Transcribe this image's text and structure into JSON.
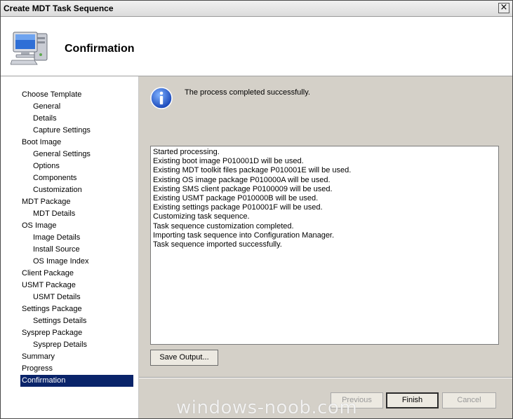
{
  "window": {
    "title": "Create MDT Task Sequence",
    "close_glyph": "×"
  },
  "header": {
    "title": "Confirmation",
    "icon": "computer-icon"
  },
  "sidebar": {
    "items": [
      {
        "label": "Choose Template",
        "level": 0
      },
      {
        "label": "General",
        "level": 1
      },
      {
        "label": "Details",
        "level": 1
      },
      {
        "label": "Capture Settings",
        "level": 1
      },
      {
        "label": "Boot Image",
        "level": 0
      },
      {
        "label": "General Settings",
        "level": 1
      },
      {
        "label": "Options",
        "level": 1
      },
      {
        "label": "Components",
        "level": 1
      },
      {
        "label": "Customization",
        "level": 1
      },
      {
        "label": "MDT Package",
        "level": 0
      },
      {
        "label": "MDT Details",
        "level": 1
      },
      {
        "label": "OS Image",
        "level": 0
      },
      {
        "label": "Image Details",
        "level": 1
      },
      {
        "label": "Install Source",
        "level": 1
      },
      {
        "label": "OS Image Index",
        "level": 1
      },
      {
        "label": "Client Package",
        "level": 0
      },
      {
        "label": "USMT Package",
        "level": 0
      },
      {
        "label": "USMT Details",
        "level": 1
      },
      {
        "label": "Settings Package",
        "level": 0
      },
      {
        "label": "Settings Details",
        "level": 1
      },
      {
        "label": "Sysprep Package",
        "level": 0
      },
      {
        "label": "Sysprep Details",
        "level": 1
      },
      {
        "label": "Summary",
        "level": 0
      },
      {
        "label": "Progress",
        "level": 0
      },
      {
        "label": "Confirmation",
        "level": 0,
        "selected": true
      }
    ]
  },
  "main": {
    "status_icon": "info-icon",
    "status_message": "The process completed successfully.",
    "output_lines": [
      "Started processing.",
      "Existing boot image P010001D will be used.",
      "Existing MDT toolkit files package P010001E will be used.",
      "Existing OS image package P010000A will be used.",
      "Existing SMS client package P0100009 will be used.",
      "Existing USMT package P010000B will be used.",
      "Existing settings package P010001F will be used.",
      "Customizing task sequence.",
      "Task sequence customization completed.",
      "Importing task sequence into Configuration Manager.",
      "Task sequence imported successfully."
    ],
    "save_output_label": "Save Output..."
  },
  "footer": {
    "previous_label": "Previous",
    "finish_label": "Finish",
    "cancel_label": "Cancel"
  },
  "watermark": "windows-noob.com",
  "colors": {
    "selection": "#0a246a",
    "dialog_bg": "#d4d0c8"
  }
}
